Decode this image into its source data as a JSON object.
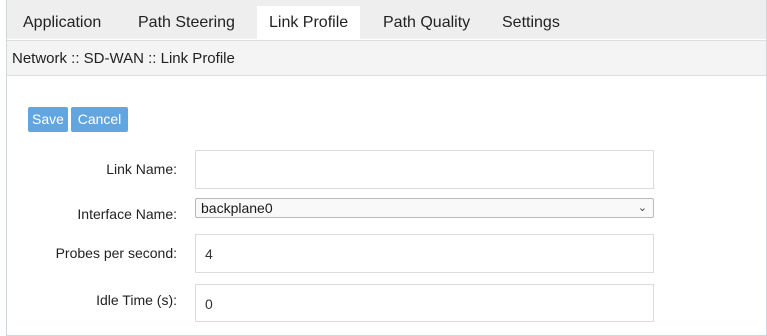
{
  "tabs": [
    {
      "label": "Application",
      "active": false
    },
    {
      "label": "Path Steering",
      "active": false
    },
    {
      "label": "Link Profile",
      "active": true
    },
    {
      "label": "Path Quality",
      "active": false
    },
    {
      "label": "Settings",
      "active": false
    }
  ],
  "breadcrumb": "Network :: SD-WAN :: Link Profile",
  "toolbar": {
    "save_label": "Save",
    "cancel_label": "Cancel"
  },
  "form": {
    "link_name": {
      "label": "Link Name:",
      "value": ""
    },
    "interface_name": {
      "label": "Interface Name:",
      "value": "backplane0"
    },
    "probes_per_second": {
      "label": "Probes per second:",
      "value": "4"
    },
    "idle_time": {
      "label": "Idle Time (s):",
      "value": "0"
    }
  },
  "colors": {
    "button": "#62a6e1",
    "tabbar": "#eeeeee",
    "breadcrumb_bg": "#f4f4f4"
  },
  "icons": {
    "select_arrow": "chevron-down-icon"
  }
}
